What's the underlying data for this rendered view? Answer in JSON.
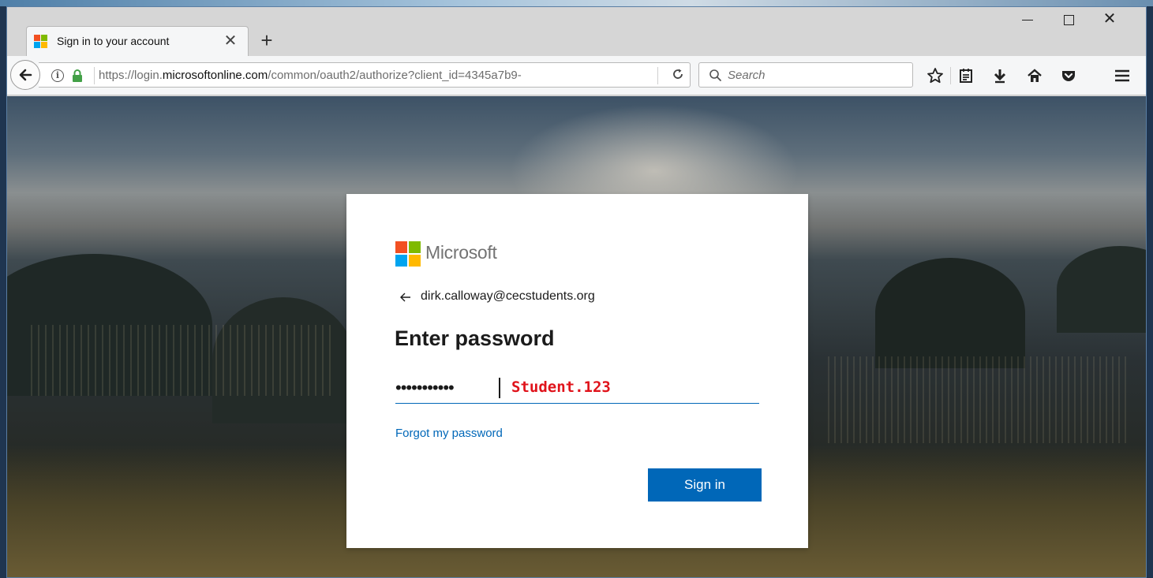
{
  "browser": {
    "tab": {
      "title": "Sign in to your account",
      "close_glyph": "✕",
      "favicon": "microsoft-logo-icon"
    },
    "new_tab_glyph": "+",
    "window_controls": {
      "minimize": "minimize-icon",
      "maximize": "maximize-icon",
      "close_glyph": "✕"
    },
    "nav": {
      "url_prefix": "https://login.",
      "url_domain": "microsoftonline.com",
      "url_path": "/common/oauth2/authorize?client_id=4345a7b9-",
      "reload_glyph": "C",
      "search_placeholder": "Search",
      "toolbar_icons": [
        "star-icon",
        "reader-list-icon",
        "download-icon",
        "home-icon",
        "pocket-icon",
        "menu-icon"
      ]
    }
  },
  "signin": {
    "brand": "Microsoft",
    "identity": "dirk.calloway@cecstudents.org",
    "heading": "Enter password",
    "password_masked": "•••••••••••",
    "password_annotation": "Student.123",
    "forgot_link": "Forgot my password",
    "submit_label": "Sign in"
  },
  "colors": {
    "ms_red": "#f25022",
    "ms_green": "#7fba00",
    "ms_blue": "#00a4ef",
    "ms_yellow": "#ffb900",
    "accent": "#0067b8",
    "annotation_red": "#e0131b"
  }
}
